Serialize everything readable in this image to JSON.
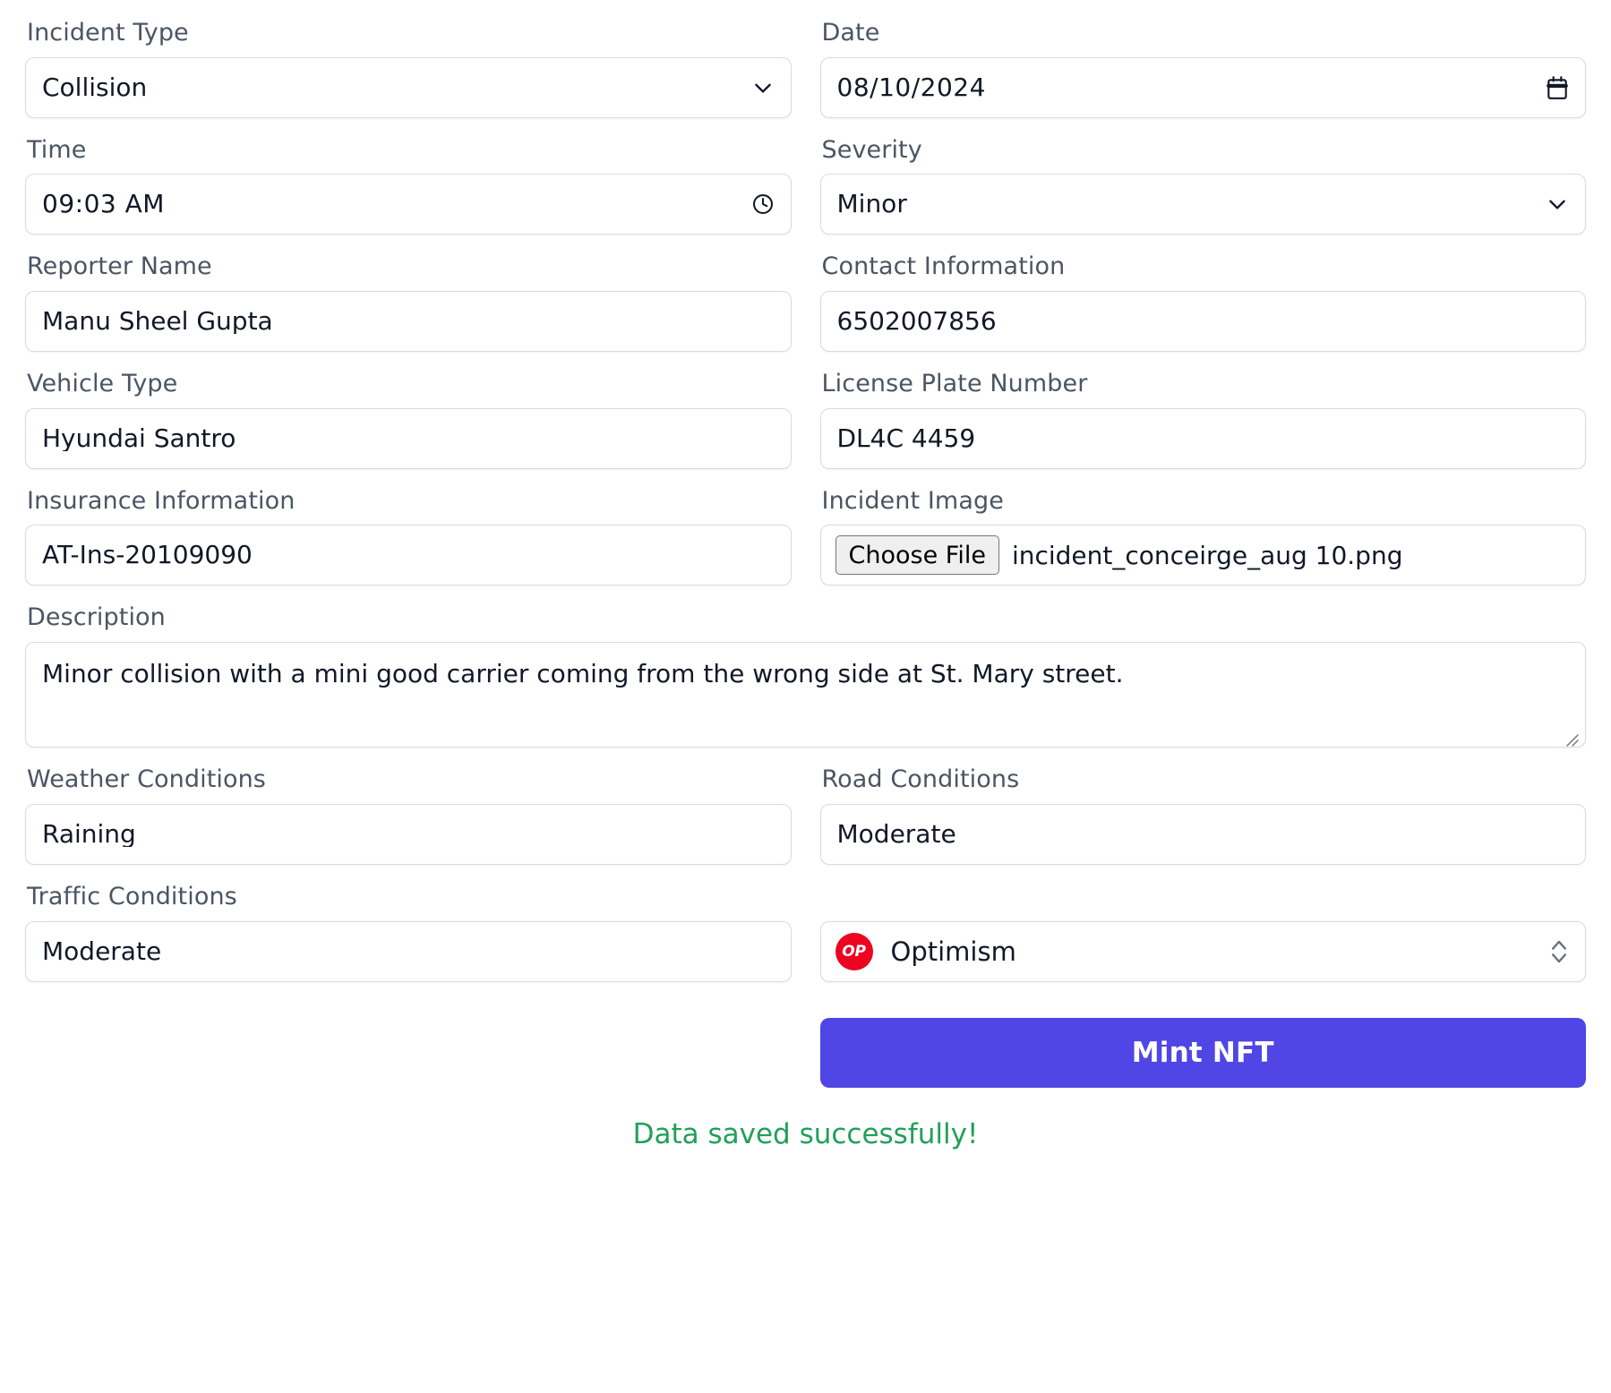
{
  "fields": {
    "incident_type": {
      "label": "Incident Type",
      "value": "Collision",
      "icon": "chevron-down-icon"
    },
    "date": {
      "label": "Date",
      "value": "08/10/2024",
      "icon": "calendar-icon"
    },
    "time": {
      "label": "Time",
      "value": "09:03 AM",
      "icon": "clock-icon"
    },
    "severity": {
      "label": "Severity",
      "value": "Minor",
      "icon": "chevron-down-icon"
    },
    "reporter_name": {
      "label": "Reporter Name",
      "value": "Manu Sheel Gupta"
    },
    "contact_information": {
      "label": "Contact Information",
      "value": "6502007856"
    },
    "vehicle_type": {
      "label": "Vehicle Type",
      "value": "Hyundai Santro"
    },
    "license_plate_number": {
      "label": "License Plate Number",
      "value": "DL4C 4459"
    },
    "insurance_information": {
      "label": "Insurance Information",
      "value": "AT-Ins-20109090"
    },
    "incident_image": {
      "label": "Incident Image",
      "button_label": "Choose File",
      "file_name": "incident_conceirge_aug 10.png"
    },
    "description": {
      "label": "Description",
      "value": "Minor collision with a mini good carrier coming from the wrong side at St. Mary street."
    },
    "weather_conditions": {
      "label": "Weather Conditions",
      "value": "Raining"
    },
    "road_conditions": {
      "label": "Road Conditions",
      "value": "Moderate"
    },
    "traffic_conditions": {
      "label": "Traffic Conditions",
      "value": "Moderate"
    }
  },
  "network_selector": {
    "badge_text": "OP",
    "name": "Optimism",
    "badge_color": "#ec0420",
    "icon": "chevron-up-down-icon"
  },
  "actions": {
    "mint_label": "Mint NFT",
    "mint_color": "#4f46e5"
  },
  "status": {
    "message": "Data saved successfully!",
    "color": "#21a05a"
  }
}
